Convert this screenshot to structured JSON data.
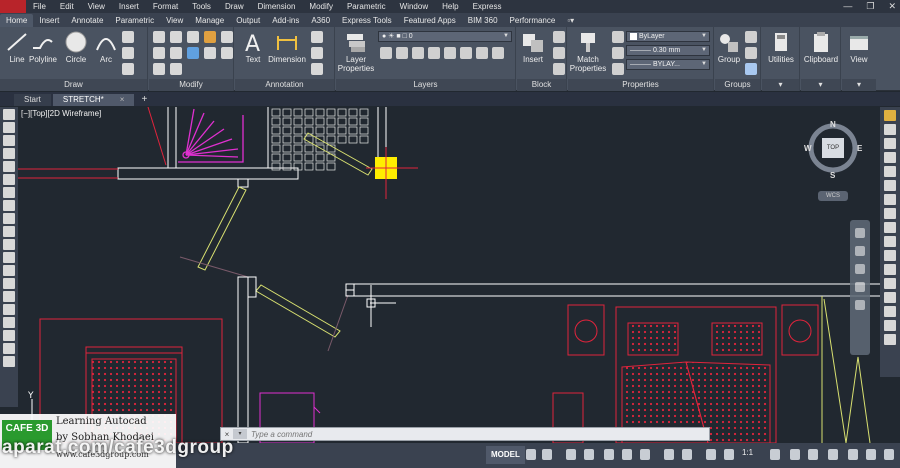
{
  "menubar": {
    "items": [
      "File",
      "Edit",
      "View",
      "Insert",
      "Format",
      "Tools",
      "Draw",
      "Dimension",
      "Modify",
      "Parametric",
      "Window",
      "Help",
      "Express"
    ]
  },
  "ribbon_tabs": {
    "items": [
      "Home",
      "Insert",
      "Annotate",
      "Parametric",
      "View",
      "Manage",
      "Output",
      "Add-ins",
      "A360",
      "Express Tools",
      "Featured Apps",
      "BIM 360",
      "Performance"
    ],
    "active": "Home"
  },
  "ribbon": {
    "draw": {
      "title": "Draw",
      "line": "Line",
      "polyline": "Polyline",
      "circle": "Circle",
      "arc": "Arc"
    },
    "modify": {
      "title": "Modify"
    },
    "annotation": {
      "title": "Annotation",
      "text": "Text",
      "dimension": "Dimension"
    },
    "layers": {
      "title": "Layers",
      "layer_properties": "Layer Properties",
      "current_layer": "0"
    },
    "block": {
      "title": "Block",
      "insert": "Insert"
    },
    "properties": {
      "title": "Properties",
      "match": "Match Properties",
      "color": "ByLayer",
      "lineweight": "0.30 mm",
      "linetype": "BYLAY..."
    },
    "groups": {
      "title": "Groups",
      "group": "Group"
    },
    "utilities": {
      "label": "Utilities"
    },
    "clipboard": {
      "label": "Clipboard"
    },
    "view": {
      "label": "View"
    }
  },
  "file_tabs": {
    "items": [
      {
        "label": "Start",
        "active": false
      },
      {
        "label": "STRETCH*",
        "active": true
      }
    ]
  },
  "viewport": {
    "label": "[−][Top][2D Wireframe]"
  },
  "viewcube": {
    "top": "TOP",
    "north": "N",
    "south": "S",
    "east": "E",
    "west": "W",
    "wcs": "WCS"
  },
  "command": {
    "placeholder": "Type a command"
  },
  "statusbar": {
    "model": "MODEL",
    "scale": "1:1"
  },
  "watermark": {
    "logo": "CAFE 3D",
    "line1": "Learning Autocad",
    "line2": "by Sobhan Khodaei",
    "line3": "www.cafe3dgroup.com",
    "aparat": "aparat.com/cafe3dgroup"
  },
  "colors": {
    "drawing_bg": "#212830",
    "wall": "#ffffff",
    "furniture": "#e0243c",
    "door": "#d8e070",
    "grip": "#ffee00",
    "arc_magenta": "#e030d0"
  },
  "icons": {
    "app": "autocad-app-icon",
    "line": "line-icon",
    "polyline": "polyline-icon",
    "circle": "circle-icon",
    "arc": "arc-icon",
    "text": "text-icon",
    "dimension": "dimension-icon"
  }
}
